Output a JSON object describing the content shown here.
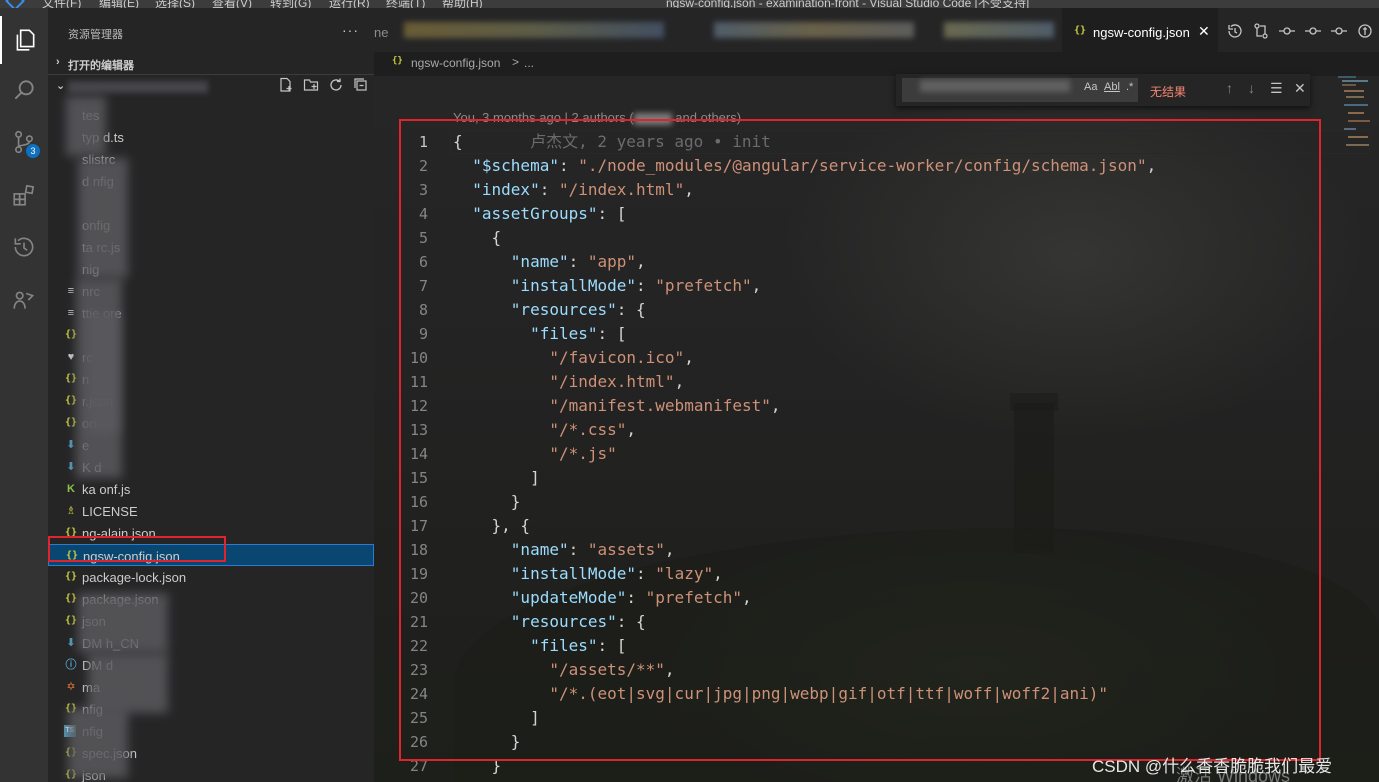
{
  "window": {
    "title": "ngsw-config.json - examination-front - Visual Studio Code [不受支持]",
    "menu": [
      "文件(F)",
      "编辑(E)",
      "选择(S)",
      "查看(V)",
      "转到(G)",
      "运行(R)",
      "终端(T)",
      "帮助(H)"
    ]
  },
  "activity_bar": {
    "items": [
      {
        "name": "explorer",
        "icon": "files-icon",
        "active": true
      },
      {
        "name": "search",
        "icon": "search-icon"
      },
      {
        "name": "source-control",
        "icon": "source-control-icon",
        "badge": "3"
      },
      {
        "name": "extensions",
        "icon": "extensions-icon"
      },
      {
        "name": "timeline",
        "icon": "history-icon"
      },
      {
        "name": "live-share",
        "icon": "share-icon"
      }
    ]
  },
  "sidebar": {
    "title": "资源管理器",
    "more": "···",
    "open_editors": "打开的编辑器",
    "files": [
      {
        "name": "tes",
        "icon": "",
        "icon_class": ""
      },
      {
        "name": "typ      d.ts",
        "icon": "",
        "icon_class": ""
      },
      {
        "name": "         slistrc",
        "icon": "",
        "icon_class": ""
      },
      {
        "name": "d        nfig",
        "icon": "",
        "icon_class": ""
      },
      {
        "name": "",
        "icon": "",
        "icon_class": ""
      },
      {
        "name": "         onfig",
        "icon": "",
        "icon_class": ""
      },
      {
        "name": "         ta       rc.js",
        "icon": "",
        "icon_class": ""
      },
      {
        "name": "         nig",
        "icon": "",
        "icon_class": ""
      },
      {
        "name": "         nrc",
        "icon": "≡",
        "icon_class": "lines"
      },
      {
        "name": "         ttie      ore",
        "icon": "≡",
        "icon_class": "lines"
      },
      {
        "name": "",
        "icon": "{}",
        "icon_class": "json"
      },
      {
        "name": "         rc",
        "icon": "♥",
        "icon_class": "heart"
      },
      {
        "name": "         n",
        "icon": "{}",
        "icon_class": "json"
      },
      {
        "name": "         r.json",
        "icon": "{}",
        "icon_class": "json"
      },
      {
        "name": "         on",
        "icon": "{}",
        "icon_class": "json"
      },
      {
        "name": "         e",
        "icon": "⬇",
        "icon_class": "down"
      },
      {
        "name": "K        d",
        "icon": "⬇",
        "icon_class": "down"
      },
      {
        "name": "ka       onf.js",
        "icon": "K",
        "icon_class": "karma"
      },
      {
        "name": "LICENSE",
        "icon": "♗",
        "icon_class": "lic"
      },
      {
        "name": "ng-alain.json",
        "icon": "{}",
        "icon_class": "json"
      },
      {
        "name": "ngsw-config.json",
        "icon": "{}",
        "icon_class": "json",
        "selected": true
      },
      {
        "name": "package-lock.json",
        "icon": "{}",
        "icon_class": "json"
      },
      {
        "name": "package.json",
        "icon": "{}",
        "icon_class": "json"
      },
      {
        "name": "         json",
        "icon": "{}",
        "icon_class": "json"
      },
      {
        "name": "         DM      h_CN",
        "icon": "⬇",
        "icon_class": "down"
      },
      {
        "name": "         DM      d",
        "icon": "ⓘ",
        "icon_class": "info"
      },
      {
        "name": "         ma",
        "icon": "✡",
        "icon_class": "ang"
      },
      {
        "name": "         nfig",
        "icon": "{}",
        "icon_class": "json"
      },
      {
        "name": "         nfig",
        "icon": "TS",
        "icon_class": "ts"
      },
      {
        "name": "         spec.json",
        "icon": "{}",
        "icon_class": "json"
      },
      {
        "name": "         json",
        "icon": "{}",
        "icon_class": "json"
      }
    ]
  },
  "editor": {
    "tab_partial": "ne",
    "active_tab": {
      "name": "ngsw-config.json",
      "icon": "{}",
      "close": "✕"
    },
    "breadcrumb": {
      "file": "ngsw-config.json",
      "sep": ">",
      "more": "..."
    },
    "find_widget": {
      "match_case": "Aa",
      "whole_word": "Abl",
      "regex": ".*",
      "result": "无结果",
      "prev": "↑",
      "next": "↓",
      "selection": "☰",
      "close": "✕"
    },
    "blame_header": {
      "prefix": "You, 3 months ago | 2 authors (",
      "suffix": " and others)"
    },
    "inline_blame": "卢杰文, 2 years ago • init",
    "lines": [
      [
        [
          "p",
          "{"
        ]
      ],
      [
        [
          "p",
          "  "
        ],
        [
          "k",
          "\"$schema\""
        ],
        [
          "p",
          ": "
        ],
        [
          "s",
          "\"./node_modules/@angular/service-worker/config/schema.json\""
        ],
        [
          "p",
          ","
        ]
      ],
      [
        [
          "p",
          "  "
        ],
        [
          "k",
          "\"index\""
        ],
        [
          "p",
          ": "
        ],
        [
          "s",
          "\"/index.html\""
        ],
        [
          "p",
          ","
        ]
      ],
      [
        [
          "p",
          "  "
        ],
        [
          "k",
          "\"assetGroups\""
        ],
        [
          "p",
          ": ["
        ]
      ],
      [
        [
          "p",
          "    {"
        ]
      ],
      [
        [
          "p",
          "      "
        ],
        [
          "k",
          "\"name\""
        ],
        [
          "p",
          ": "
        ],
        [
          "s",
          "\"app\""
        ],
        [
          "p",
          ","
        ]
      ],
      [
        [
          "p",
          "      "
        ],
        [
          "k",
          "\"installMode\""
        ],
        [
          "p",
          ": "
        ],
        [
          "s",
          "\"prefetch\""
        ],
        [
          "p",
          ","
        ]
      ],
      [
        [
          "p",
          "      "
        ],
        [
          "k",
          "\"resources\""
        ],
        [
          "p",
          ": {"
        ]
      ],
      [
        [
          "p",
          "        "
        ],
        [
          "k",
          "\"files\""
        ],
        [
          "p",
          ": ["
        ]
      ],
      [
        [
          "p",
          "          "
        ],
        [
          "s",
          "\"/favicon.ico\""
        ],
        [
          "p",
          ","
        ]
      ],
      [
        [
          "p",
          "          "
        ],
        [
          "s",
          "\"/index.html\""
        ],
        [
          "p",
          ","
        ]
      ],
      [
        [
          "p",
          "          "
        ],
        [
          "s",
          "\"/manifest.webmanifest\""
        ],
        [
          "p",
          ","
        ]
      ],
      [
        [
          "p",
          "          "
        ],
        [
          "s",
          "\"/*.css\""
        ],
        [
          "p",
          ","
        ]
      ],
      [
        [
          "p",
          "          "
        ],
        [
          "s",
          "\"/*.js\""
        ]
      ],
      [
        [
          "p",
          "        ]"
        ]
      ],
      [
        [
          "p",
          "      }"
        ]
      ],
      [
        [
          "p",
          "    }, {"
        ]
      ],
      [
        [
          "p",
          "      "
        ],
        [
          "k",
          "\"name\""
        ],
        [
          "p",
          ": "
        ],
        [
          "s",
          "\"assets\""
        ],
        [
          "p",
          ","
        ]
      ],
      [
        [
          "p",
          "      "
        ],
        [
          "k",
          "\"installMode\""
        ],
        [
          "p",
          ": "
        ],
        [
          "s",
          "\"lazy\""
        ],
        [
          "p",
          ","
        ]
      ],
      [
        [
          "p",
          "      "
        ],
        [
          "k",
          "\"updateMode\""
        ],
        [
          "p",
          ": "
        ],
        [
          "s",
          "\"prefetch\""
        ],
        [
          "p",
          ","
        ]
      ],
      [
        [
          "p",
          "      "
        ],
        [
          "k",
          "\"resources\""
        ],
        [
          "p",
          ": {"
        ]
      ],
      [
        [
          "p",
          "        "
        ],
        [
          "k",
          "\"files\""
        ],
        [
          "p",
          ": ["
        ]
      ],
      [
        [
          "p",
          "          "
        ],
        [
          "s",
          "\"/assets/**\""
        ],
        [
          "p",
          ","
        ]
      ],
      [
        [
          "p",
          "          "
        ],
        [
          "s",
          "\"/*.(eot|svg|cur|jpg|png|webp|gif|otf|ttf|woff|woff2|ani)\""
        ]
      ],
      [
        [
          "p",
          "        ]"
        ]
      ],
      [
        [
          "p",
          "      }"
        ]
      ],
      [
        [
          "p",
          "    }"
        ]
      ]
    ]
  },
  "watermark": "CSDN @什么香香脆脆我们最爱",
  "activate_windows": "激活 Windows",
  "colors": {
    "accent": "#007acc",
    "highlight_box": "#e0242e",
    "selected_row": "#094771"
  }
}
